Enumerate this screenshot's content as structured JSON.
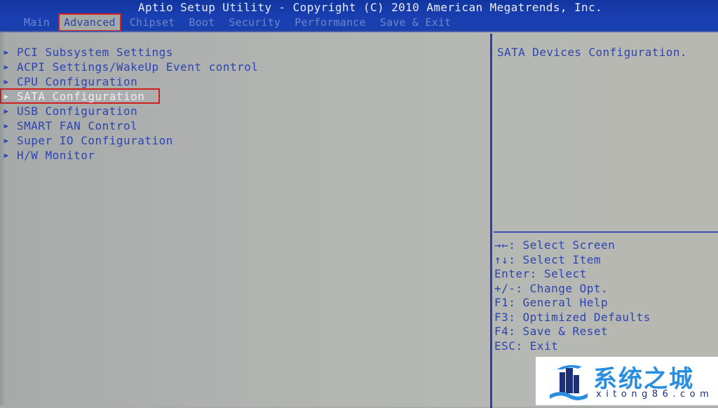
{
  "header": {
    "title": "Aptio Setup Utility - Copyright (C) 2010 American Megatrends, Inc.",
    "tabs": [
      {
        "label": "Main",
        "active": false
      },
      {
        "label": "Advanced",
        "active": true
      },
      {
        "label": "Chipset",
        "active": false
      },
      {
        "label": "Boot",
        "active": false
      },
      {
        "label": "Security",
        "active": false
      },
      {
        "label": "Performance",
        "active": false
      },
      {
        "label": "Save & Exit",
        "active": false
      }
    ]
  },
  "menu": {
    "items": [
      {
        "label": "PCI Subsystem Settings",
        "icon": "submenu-arrow-icon"
      },
      {
        "label": "ACPI Settings/WakeUp Event control",
        "icon": "submenu-arrow-icon"
      },
      {
        "label": "CPU Configuration",
        "icon": "submenu-arrow-icon"
      },
      {
        "label": "SATA Configuration",
        "icon": "submenu-arrow-icon",
        "selected": true
      },
      {
        "label": "USB Configuration",
        "icon": "submenu-arrow-icon"
      },
      {
        "label": "SMART FAN Control",
        "icon": "submenu-arrow-icon"
      },
      {
        "label": "Super IO Configuration",
        "icon": "submenu-arrow-icon"
      },
      {
        "label": "H/W Monitor",
        "icon": "submenu-arrow-icon"
      }
    ],
    "arrow_glyph": "▶"
  },
  "help": {
    "description": "SATA Devices Configuration."
  },
  "keys": [
    {
      "key": "→←",
      "action": ": Select Screen"
    },
    {
      "key": "↑↓",
      "action": ": Select Item"
    },
    {
      "key": "Enter",
      "action": ": Select"
    },
    {
      "key": "+/-",
      "action": ": Change Opt."
    },
    {
      "key": "F1",
      "action": ": General Help"
    },
    {
      "key": "F3",
      "action": ": Optimized Defaults"
    },
    {
      "key": "F4",
      "action": ": Save & Reset"
    },
    {
      "key": "ESC",
      "action": ": Exit"
    }
  ],
  "watermark": {
    "name": "系统之城",
    "url": "xitong86.com"
  },
  "colors": {
    "header_bg": "#1a3fb2",
    "text_blue": "#2d44b2",
    "selected_text": "#eceef2",
    "highlight_box": "#d32020",
    "panel_bg": "#b1b4b1"
  }
}
